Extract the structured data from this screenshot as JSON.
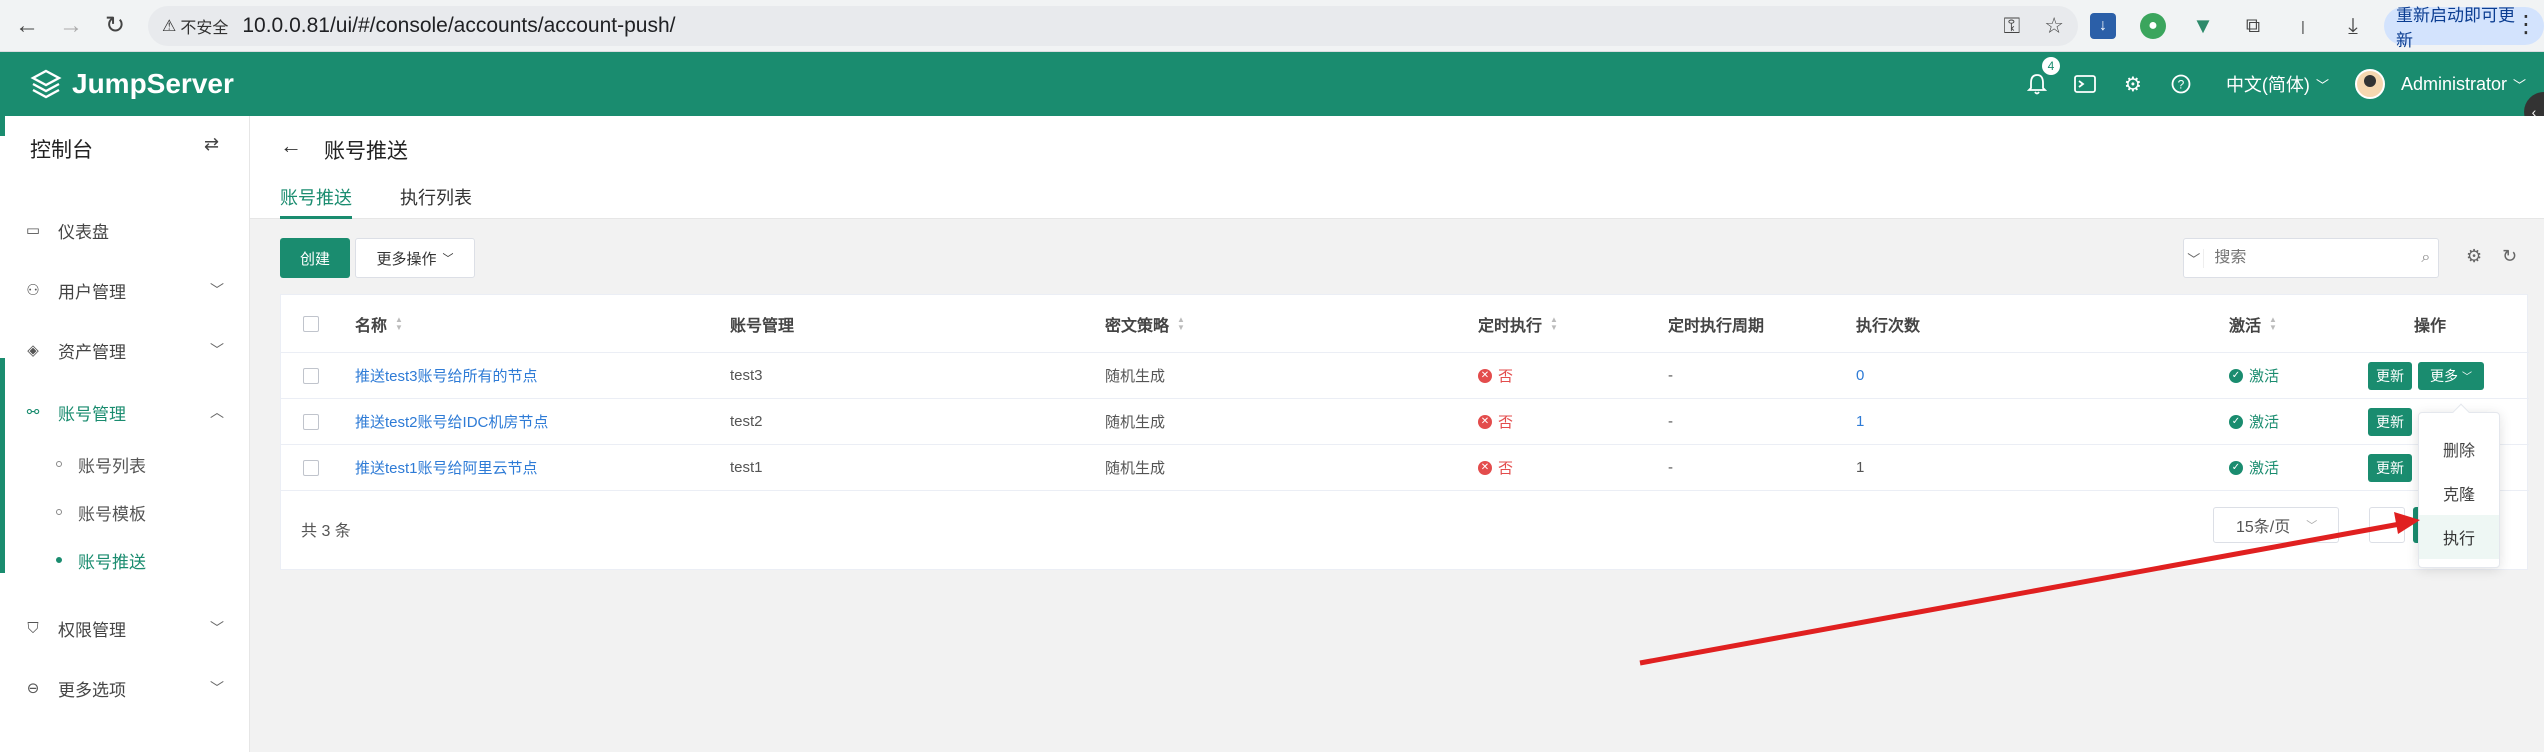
{
  "browser": {
    "security_label": "不安全",
    "url": "10.0.0.81/ui/#/console/accounts/account-push/",
    "update_button": "重新启动即可更新"
  },
  "header": {
    "brand": "JumpServer",
    "notification_count": "4",
    "language": "中文(简体)",
    "user": "Administrator"
  },
  "sidebar": {
    "title": "控制台",
    "items": [
      {
        "label": "仪表盘"
      },
      {
        "label": "用户管理"
      },
      {
        "label": "资产管理"
      },
      {
        "label": "账号管理"
      },
      {
        "label": "权限管理"
      },
      {
        "label": "更多选项"
      }
    ],
    "sub_items": [
      {
        "label": "账号列表"
      },
      {
        "label": "账号模板"
      },
      {
        "label": "账号推送"
      }
    ]
  },
  "page": {
    "title": "账号推送",
    "tabs": [
      {
        "label": "账号推送"
      },
      {
        "label": "执行列表"
      }
    ]
  },
  "toolbar": {
    "create": "创建",
    "more_actions": "更多操作",
    "search_placeholder": "搜索"
  },
  "table": {
    "columns": [
      "名称",
      "账号管理",
      "密文策略",
      "定时执行",
      "定时执行周期",
      "执行次数",
      "激活",
      "操作"
    ],
    "rows": [
      {
        "name": "推送test3账号给所有的节点",
        "account": "test3",
        "secret_strategy": "随机生成",
        "scheduled": "否",
        "period": "-",
        "exec_count": "0",
        "active": "激活"
      },
      {
        "name": "推送test2账号给IDC机房节点",
        "account": "test2",
        "secret_strategy": "随机生成",
        "scheduled": "否",
        "period": "-",
        "exec_count": "1",
        "active": "激活"
      },
      {
        "name": "推送test1账号给阿里云节点",
        "account": "test1",
        "secret_strategy": "随机生成",
        "scheduled": "否",
        "period": "-",
        "exec_count": "1",
        "active": "激活"
      }
    ],
    "update_label": "更新",
    "more_label": "更多",
    "total": "共 3 条",
    "page_size": "15条/页"
  },
  "dropdown": {
    "items": [
      "删除",
      "克隆",
      "执行"
    ]
  },
  "colors": {
    "brand": "#1a8c6f",
    "link": "#2e7bd6",
    "danger": "#e34c4c",
    "arrow": "#e02020"
  }
}
